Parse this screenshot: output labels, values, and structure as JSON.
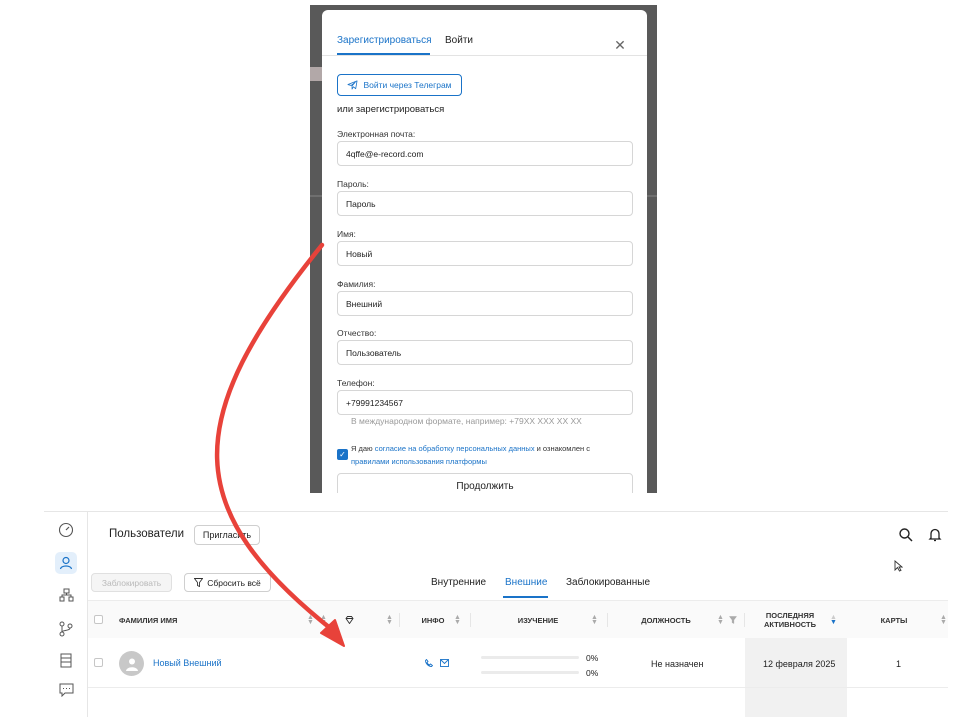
{
  "registration": {
    "tabs": [
      {
        "label": "Зарегистрироваться",
        "active": true
      },
      {
        "label": "Войти",
        "active": false
      }
    ],
    "close_icon": "close-icon",
    "telegram_button": "Войти через Телеграм",
    "or_text": "или зарегистрироваться",
    "fields": [
      {
        "label": "Электронная почта:",
        "value": "4qffe@e-record.com"
      },
      {
        "label": "Пароль:",
        "value": "Пароль"
      },
      {
        "label": "Имя:",
        "value": "Новый"
      },
      {
        "label": "Фамилия:",
        "value": "Внешний"
      },
      {
        "label": "Отчество:",
        "value": "Пользователь"
      },
      {
        "label": "Телефон:",
        "value": "+79991234567"
      }
    ],
    "phone_hint": "В международном формате, например: +79XX XXX XX XX",
    "consent": {
      "checked": true,
      "part1": "Я даю ",
      "link1": "согласие на обработку персональных данных",
      "part2": " и ознакомлен с ",
      "link2": "правилами использования платформы"
    },
    "continue_button": "Продолжить"
  },
  "users_page": {
    "title": "Пользователи",
    "invite_button": "Пригласить",
    "block_button": "Заблокировать",
    "reset_button": "Сбросить всё",
    "segments": [
      {
        "label": "Внутренние",
        "active": false
      },
      {
        "label": "Внешние",
        "active": true
      },
      {
        "label": "Заблокированные",
        "active": false
      }
    ],
    "columns": {
      "name": "ФАМИЛИЯ ИМЯ",
      "info": "ИНФО",
      "study": "ИЗУЧЕНИЕ",
      "position": "ДОЛЖНОСТЬ",
      "last_activity": "ПОСЛЕДНЯЯ АКТИВНОСТЬ",
      "cards": "КАРТЫ"
    },
    "rows": [
      {
        "name": "Новый Внешний",
        "progress_1": "0%",
        "progress_2": "0%",
        "position": "Не назначен",
        "last_activity": "12 февраля 2025",
        "cards": "1"
      }
    ]
  },
  "colors": {
    "accent": "#1a73c8",
    "arrow": "#e8423a"
  }
}
